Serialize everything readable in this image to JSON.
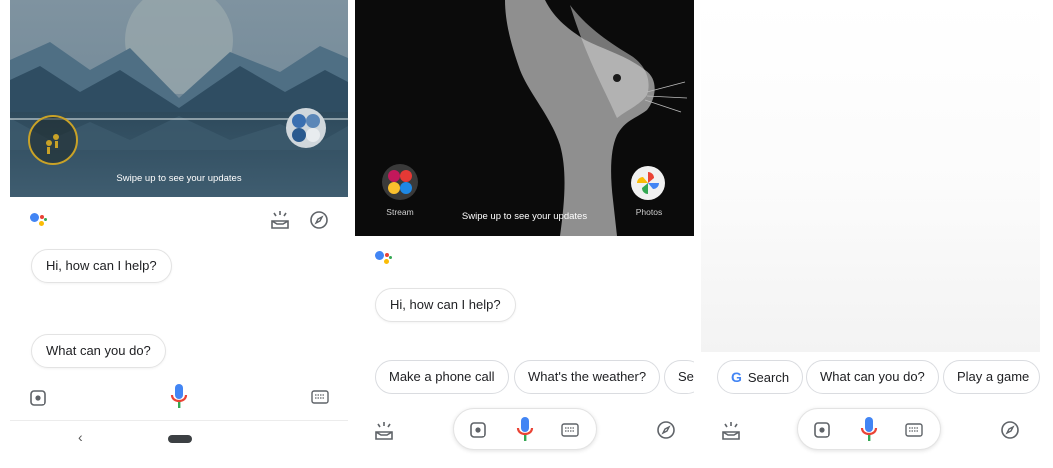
{
  "panel1": {
    "swipe_text": "Swipe up to see your updates",
    "greeting": "Hi, how can I help?",
    "suggestion": "What can you do?",
    "nav_back_glyph": "‹"
  },
  "panel2": {
    "swipe_text": "Swipe up to see your updates",
    "stream_label": "Stream",
    "photos_label": "Photos",
    "greeting": "Hi, how can I help?",
    "chips": [
      "Make a phone call",
      "What's the weather?",
      "Set"
    ]
  },
  "panel3": {
    "chips": [
      "Search",
      "What can you do?",
      "Play a game"
    ],
    "google_g": "G"
  },
  "colors": {
    "blue": "#4285F4",
    "red": "#EA4335",
    "yellow": "#FBBC05",
    "green": "#34A853"
  }
}
